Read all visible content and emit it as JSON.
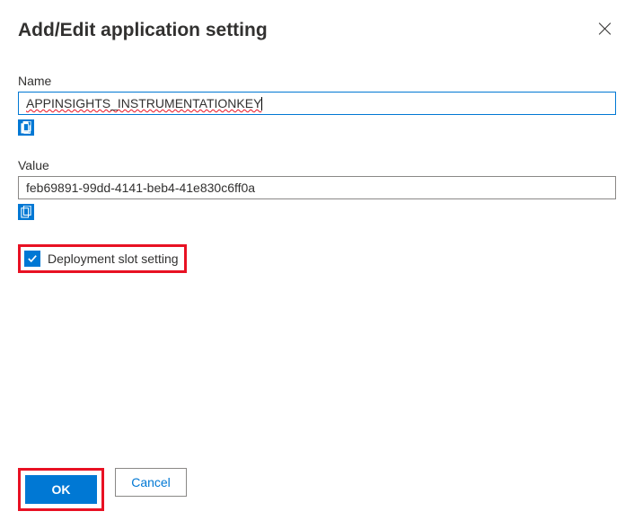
{
  "header": {
    "title": "Add/Edit application setting"
  },
  "fields": {
    "name": {
      "label": "Name",
      "value": "APPINSIGHTS_INSTRUMENTATIONKEY"
    },
    "value": {
      "label": "Value",
      "value": "feb69891-99dd-4141-beb4-41e830c6ff0a"
    }
  },
  "checkbox": {
    "checked": true,
    "label": "Deployment slot setting"
  },
  "footer": {
    "ok": "OK",
    "cancel": "Cancel"
  }
}
